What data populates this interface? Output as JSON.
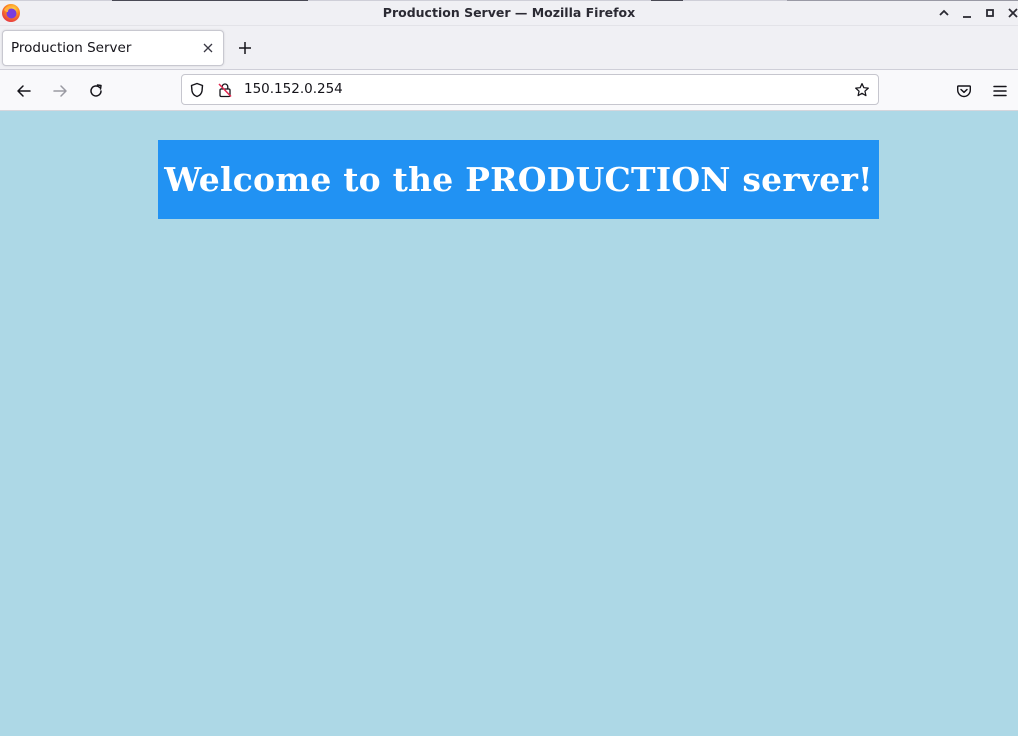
{
  "window": {
    "title": "Production Server — Mozilla Firefox"
  },
  "tabs": [
    {
      "label": "Production Server",
      "active": true
    }
  ],
  "navbar": {
    "url": "150.152.0.254"
  },
  "page": {
    "heading": "Welcome to the PRODUCTION server!",
    "background_color": "#add8e6",
    "banner_color": "#2192f3"
  },
  "icons": {
    "app": "firefox-icon",
    "back": "back-arrow-icon",
    "forward": "forward-arrow-icon",
    "reload": "reload-icon",
    "shield": "shield-icon",
    "insecure": "insecure-lock-icon",
    "bookmark": "star-icon",
    "pocket": "pocket-icon",
    "menu": "hamburger-menu-icon"
  }
}
